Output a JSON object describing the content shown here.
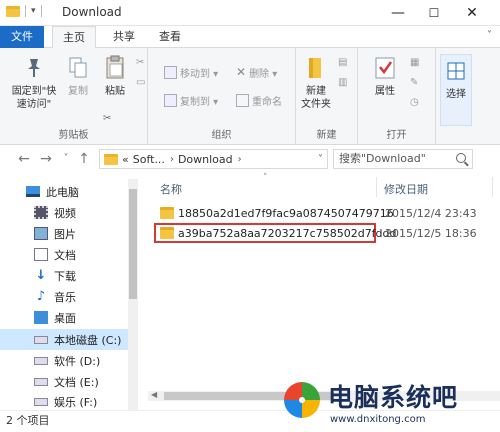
{
  "window": {
    "title": "Download",
    "minimize_glyph": "—",
    "maximize_glyph": "☐",
    "close_glyph": "✕"
  },
  "tabs": {
    "file": "文件",
    "home": "主页",
    "share": "共享",
    "view": "查看"
  },
  "ribbon": {
    "pin_label": "固定到\"快\n速访问\"",
    "copy_label": "复制",
    "paste_label": "粘贴",
    "clipboard_group": "剪贴板",
    "move_to": "移动到 ▾",
    "copy_to": "复制到 ▾",
    "delete": "删除 ▾",
    "rename": "重命名",
    "organize_group": "组织",
    "new_folder": "新建\n文件夹",
    "new_group": "新建",
    "properties": "属性",
    "open_group": "打开",
    "select": "选择"
  },
  "navbar": {
    "back": "←",
    "forward": "→",
    "recent": "˅",
    "up": "↑",
    "breadcrumb": [
      "«",
      "Soft...",
      "Download"
    ],
    "search_placeholder": "搜索\"Download\""
  },
  "sidebar": {
    "items": [
      {
        "label": "此电脑",
        "icon": "computer-icon"
      },
      {
        "label": "视频",
        "icon": "video-icon"
      },
      {
        "label": "图片",
        "icon": "picture-icon"
      },
      {
        "label": "文档",
        "icon": "document-icon"
      },
      {
        "label": "下载",
        "icon": "download-icon"
      },
      {
        "label": "音乐",
        "icon": "music-icon"
      },
      {
        "label": "桌面",
        "icon": "desktop-icon"
      },
      {
        "label": "本地磁盘 (C:)",
        "icon": "drive-icon"
      },
      {
        "label": "软件 (D:)",
        "icon": "drive-icon"
      },
      {
        "label": "文档 (E:)",
        "icon": "drive-icon"
      },
      {
        "label": "娱乐 (F:)",
        "icon": "drive-icon"
      }
    ]
  },
  "filelist": {
    "columns": {
      "name": "名称",
      "modified": "修改日期"
    },
    "rows": [
      {
        "name": "18850a2d1ed7f9fac9a0874507479716",
        "modified": "2015/12/4 23:43"
      },
      {
        "name": "a39ba752a8aa7203217c758502d7fddd",
        "modified": "2015/12/5 18:36"
      }
    ]
  },
  "status": {
    "item_count": "2 个项目"
  },
  "watermark": {
    "brand": "电脑系统吧",
    "url": "www.dnxitong.com"
  },
  "colors": {
    "accent": "#1a6cc7",
    "selection": "#cde8ff",
    "highlight_box": "#d23a3a",
    "folder": "#f4c542"
  }
}
